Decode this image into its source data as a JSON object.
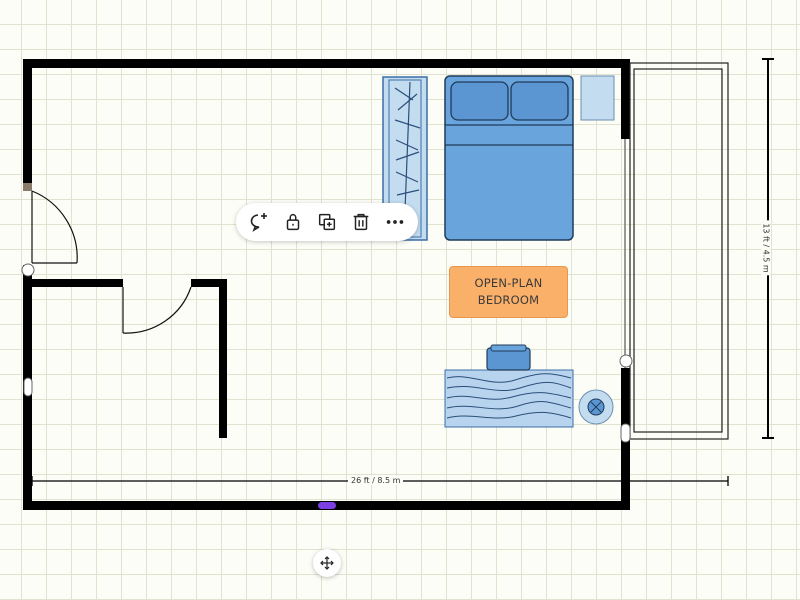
{
  "canvas": {
    "grid_color": "#dfe3cf",
    "background_color": "#fdfdf7"
  },
  "room_label": {
    "line1": "OPEN-PLAN",
    "line2": "BEDROOM",
    "fill": "#fbb06a"
  },
  "dimensions": {
    "width_label": "26 ft / 8.5 m",
    "height_label": "13 ft / 4.5 m"
  },
  "toolbar": {
    "buttons": [
      {
        "name": "comment-add",
        "icon": "speech-bubble-plus-icon"
      },
      {
        "name": "lock",
        "icon": "padlock-icon"
      },
      {
        "name": "duplicate",
        "icon": "copy-plus-icon"
      },
      {
        "name": "delete",
        "icon": "trash-icon"
      },
      {
        "name": "more",
        "icon": "ellipsis-icon"
      }
    ]
  },
  "furniture": {
    "bed": "double-bed",
    "bedside_table": "nightstand",
    "wardrobe": "closet",
    "desk": "desk-with-wood-grain",
    "chair": "office-chair",
    "plant": "potted-plant"
  },
  "colors": {
    "wall": "#000000",
    "furniture_blue": "#6aa4dc",
    "furniture_light_blue": "#c3dcf0",
    "selection_handle": "#7b3fe4"
  }
}
